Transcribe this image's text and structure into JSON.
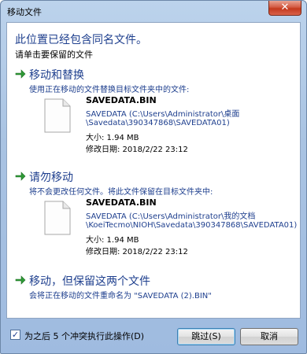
{
  "window": {
    "title": "移动文件",
    "close_glyph": "✕"
  },
  "heading": "此位置已经包含同名文件。",
  "subheading": "请单击要保留的文件",
  "options": [
    {
      "title": "移动和替换",
      "description": "使用正在移动的文件替换目标文件夹中的文件:",
      "file": {
        "name": "SAVEDATA.BIN",
        "path_line1": "SAVEDATA (C:\\Users\\Administrator\\桌面",
        "path_line2": "\\Savedata\\390347868\\SAVEDATA01)",
        "size": "大小: 1.94 MB",
        "modified": "修改日期: 2018/2/22 23:12"
      }
    },
    {
      "title": "请勿移动",
      "description": "将不会更改任何文件。将此文件保留在目标文件夹中:",
      "file": {
        "name": "SAVEDATA.BIN",
        "path_line1": "SAVEDATA (C:\\Users\\Administrator\\我的文档",
        "path_line2": "\\KoeiTecmo\\NIOH\\Savedata\\390347868\\SAVEDATA01)",
        "size": "大小: 1.94 MB",
        "modified": "修改日期: 2018/2/22 23:12"
      }
    },
    {
      "title": "移动，但保留这两个文件",
      "description": "会将正在移动的文件重命名为 \"SAVEDATA (2).BIN\""
    }
  ],
  "footer": {
    "checkbox_checked": true,
    "checkbox_mark": "✓",
    "checkbox_label": "为之后 5 个冲突执行此操作(D)",
    "skip_label": "跳过(S)",
    "cancel_label": "取消"
  },
  "colors": {
    "link": "#1e3f8e",
    "arrow": "#2e9a36"
  },
  "icons": {
    "option_arrow": "green-arrow-icon",
    "file": "file-icon"
  }
}
